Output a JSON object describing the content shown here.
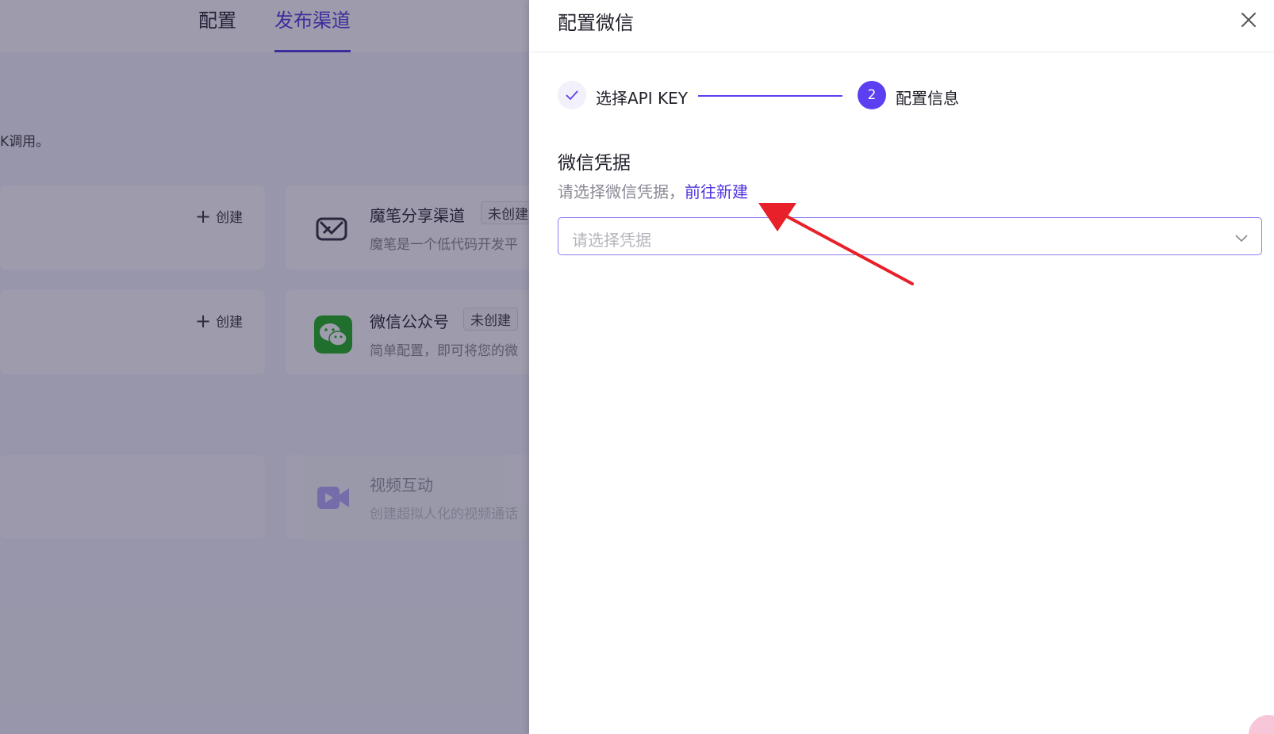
{
  "background": {
    "tabs": [
      {
        "label": "配置"
      },
      {
        "label": "发布渠道"
      }
    ],
    "description_fragment": "K调用。",
    "create_label": "创建",
    "channels": [
      {
        "title": "魔笔分享渠道",
        "tag": "未创建",
        "desc": "魔笔是一个低代码开发平"
      },
      {
        "title": "微信公众号",
        "tag": "未创建",
        "desc": "简单配置，即可将您的微"
      },
      {
        "title": "视频互动",
        "desc": "创建超拟人化的视频通话"
      }
    ]
  },
  "drawer": {
    "title": "配置微信",
    "steps": [
      {
        "label": "选择API KEY",
        "status": "done"
      },
      {
        "label": "配置信息",
        "number": "2",
        "status": "active"
      }
    ],
    "section": {
      "title": "微信凭据",
      "hint": "请选择微信凭据，",
      "link": "前往新建"
    },
    "select": {
      "placeholder": "请选择凭据"
    }
  },
  "colors": {
    "accent": "#5b3ff0",
    "link": "#4d35e0",
    "annotation_arrow": "#e8202a",
    "wechat_green": "#1aad19"
  }
}
